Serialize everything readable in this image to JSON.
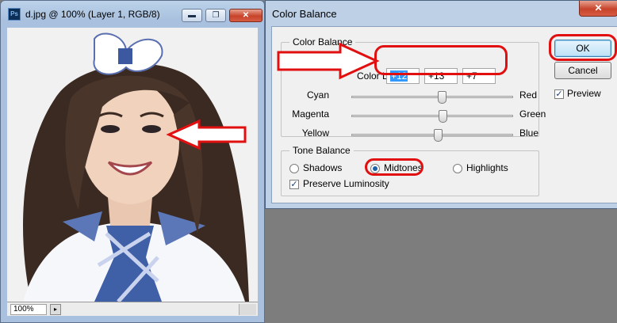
{
  "document": {
    "app_badge": "Ps",
    "title": "d.jpg @ 100% (Layer 1, RGB/8)",
    "minimize": "▬",
    "maximize": "❐",
    "close": "✕",
    "zoom": "100%"
  },
  "dialog": {
    "title": "Color Balance",
    "close": "✕",
    "color_balance": {
      "legend": "Color Balance",
      "levels_label": "Color Levels",
      "levels": [
        "+12",
        "+13",
        "+7"
      ],
      "sliders": [
        {
          "left": "Cyan",
          "right": "Red",
          "value": 12
        },
        {
          "left": "Magenta",
          "right": "Green",
          "value": 13
        },
        {
          "left": "Yellow",
          "right": "Blue",
          "value": 7
        }
      ],
      "slider_range": [
        -100,
        100
      ]
    },
    "tone_balance": {
      "legend": "Tone Balance",
      "options": [
        "Shadows",
        "Midtones",
        "Highlights"
      ],
      "selected": "Midtones",
      "preserve_luminosity": "Preserve Luminosity",
      "preserve_luminosity_checked": true
    },
    "buttons": {
      "ok": "OK",
      "cancel": "Cancel"
    },
    "preview": "Preview",
    "preview_checked": true
  },
  "colors": {
    "annotation": "#e10f0f",
    "accent": "#3399ff"
  }
}
